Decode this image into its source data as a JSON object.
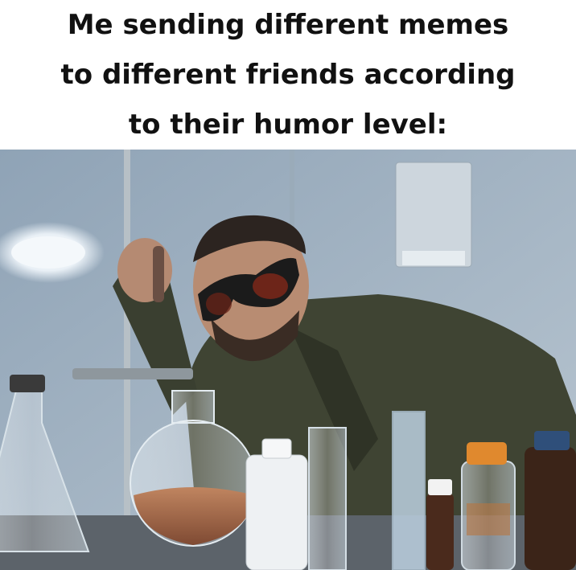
{
  "caption": {
    "line1": "Me sending different memes",
    "line2": "to different friends according",
    "line3": "to their humor level:"
  },
  "photo": {
    "subject": "man-in-goggles-icon",
    "scene": "laboratory",
    "colors": {
      "wall": "#a9b8c6",
      "jacket": "#3f4433",
      "goggles": "#1b1b1b",
      "liquid": "#a86a4a",
      "bottle_cap": "#e0892e"
    }
  }
}
